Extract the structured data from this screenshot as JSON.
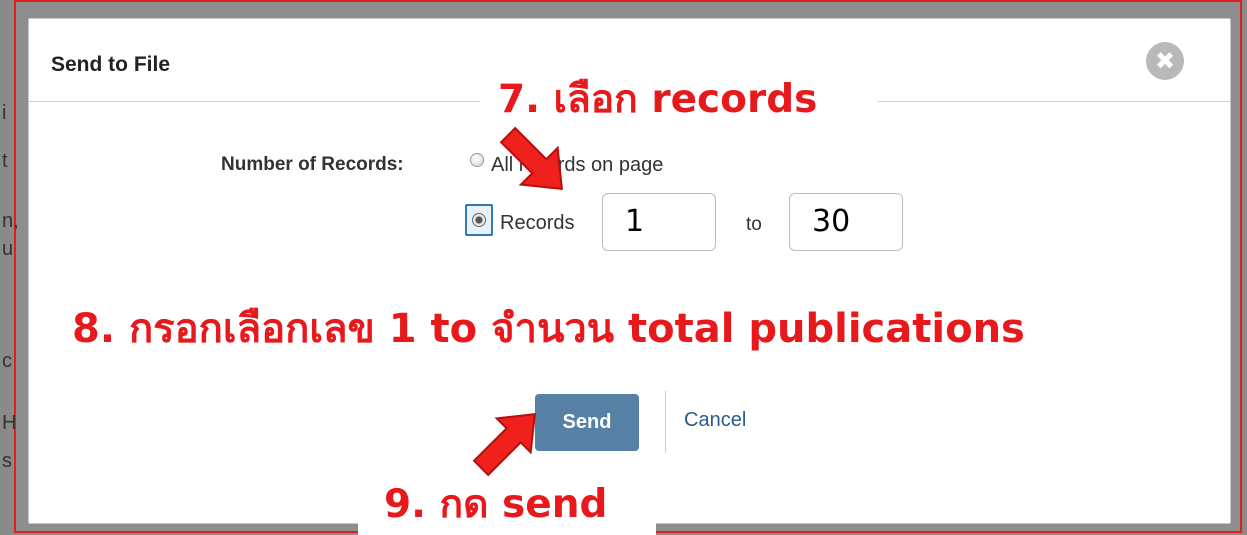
{
  "background": {
    "left_edge_letters": [
      "i",
      "t",
      "n,",
      "u",
      "c",
      "H",
      "s"
    ]
  },
  "dialog": {
    "title": "Send to File",
    "close_icon": "close-circle-x",
    "close_glyph": "✖",
    "number_of_records_label": "Number of Records:",
    "option_all_records_on_page": "All records on page",
    "option_records": "Records",
    "option_records_selected": true,
    "records_from": "1",
    "records_to_label": "to",
    "records_to": "30",
    "send_button": "Send",
    "cancel_link": "Cancel"
  },
  "annotations": {
    "step7": "7. เลือก records",
    "step8": "8. กรอกเลือกเลข 1 to จำนวน total publications",
    "step9": "9. กด send",
    "color": "#e8191c",
    "arrow_icon": "red-pointer-arrow"
  },
  "colors": {
    "accent_red": "#e0201e",
    "send_button": "#5681a5",
    "link": "#2a5d8a"
  }
}
